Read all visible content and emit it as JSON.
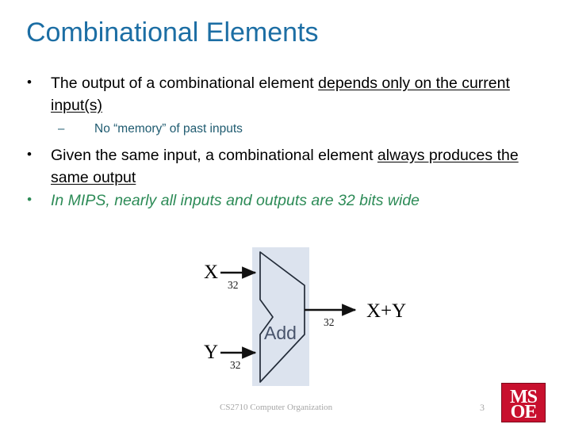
{
  "slide": {
    "title": "Combinational Elements",
    "title_color": "#1c6ea4",
    "bullets": [
      {
        "level": 1,
        "marker": "•",
        "pre": "The output of a combinational element ",
        "underlined": "depends only on the current input(s)",
        "post": "",
        "color": "#000000",
        "italic": false
      },
      {
        "level": 2,
        "marker": "–",
        "pre": "No “memory” of past inputs",
        "underlined": "",
        "post": "",
        "color": "#1f5b70",
        "italic": false
      },
      {
        "level": 1,
        "marker": "•",
        "pre": "Given the same input, a combinational element ",
        "underlined": "always produces the same output",
        "post": "",
        "color": "#000000",
        "italic": false
      },
      {
        "level": 1,
        "marker": "•",
        "pre": "In MIPS, nearly all inputs and outputs are 32 bits wide",
        "underlined": "",
        "post": "",
        "color": "#2d8b57",
        "italic": true
      }
    ]
  },
  "diagram": {
    "name": "alu-adder-diagram",
    "unit_label": "Add",
    "unit_label_color": "#47536b",
    "panel_color": "#dce3ee",
    "input_top_label": "X",
    "input_top_width": "32",
    "input_bottom_label": "Y",
    "input_bottom_width": "32",
    "output_label": "X+Y",
    "output_width": "32"
  },
  "footer": {
    "course": "CS2710 Computer Organization",
    "page_number": "3",
    "color": "#a6a6a6"
  },
  "logo": {
    "line1": "MS",
    "line2": "OE",
    "background": "#c8102e",
    "text_color": "#ffffff"
  }
}
